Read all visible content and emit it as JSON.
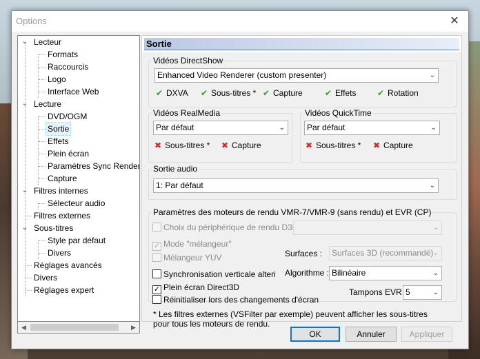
{
  "window": {
    "title": "Options",
    "close_glyph": "✕"
  },
  "tree": [
    {
      "label": "Lecteur",
      "twisty": "⌄"
    },
    {
      "label": "Formats"
    },
    {
      "label": "Raccourcis"
    },
    {
      "label": "Logo"
    },
    {
      "label": "Interface Web"
    },
    {
      "label": "Lecture",
      "twisty": "⌄"
    },
    {
      "label": "DVD/OGM"
    },
    {
      "label": "Sortie",
      "selected": true
    },
    {
      "label": "Effets"
    },
    {
      "label": "Plein écran"
    },
    {
      "label": "Paramètres Sync Render"
    },
    {
      "label": "Capture"
    },
    {
      "label": "Filtres internes",
      "twisty": "⌄"
    },
    {
      "label": "Sélecteur audio"
    },
    {
      "label": "Filtres externes"
    },
    {
      "label": "Sous-titres",
      "twisty": "⌄"
    },
    {
      "label": "Style par défaut"
    },
    {
      "label": "Divers"
    },
    {
      "label": "Réglages avancés"
    },
    {
      "label": "Divers"
    },
    {
      "label": "Réglages expert"
    }
  ],
  "page": {
    "header": "Sortie",
    "directshow": {
      "legend": "Vidéos DirectShow",
      "renderer": "Enhanced Video Renderer (custom presenter)",
      "caps": [
        "DXVA",
        "Sous-titres *",
        "Capture",
        "Effets",
        "Rotation"
      ]
    },
    "realmedia": {
      "legend": "Vidéos RealMedia",
      "value": "Par défaut",
      "caps": [
        "Sous-titres *",
        "Capture"
      ]
    },
    "quicktime": {
      "legend": "Vidéos QuickTime",
      "value": "Par défaut",
      "caps": [
        "Sous-titres *",
        "Capture"
      ]
    },
    "audio": {
      "legend": "Sortie audio",
      "value": "1: Par défaut"
    },
    "vmr": {
      "legend": "Paramètres des moteurs de rendu VMR-7/VMR-9 (sans rendu) et EVR (CP)",
      "d3d9_device": "Choix du périphérique de rendu D3D9",
      "mixer_mode": "Mode \"mélangeur\"",
      "mixer_yuv": "Mélangeur YUV",
      "vsync": "Synchronisation verticale alteri",
      "fullscreen_d3d": "Plein écran Direct3D",
      "reset_on_change": "Réinitialiser lors des changements d'écran",
      "surfaces_label": "Surfaces :",
      "surfaces_value": "Surfaces 3D (recommandé)",
      "algorithm_label": "Algorithme :",
      "algorithm_value": "Bilinéaire",
      "buffers_label": "Tampons EVR :",
      "buffers_value": "5"
    },
    "footnote": "* Les filtres externes (VSFilter par exemple) peuvent afficher les sous-titres pour tous les moteurs de rendu."
  },
  "buttons": {
    "ok": "OK",
    "cancel": "Annuler",
    "apply": "Appliquer"
  },
  "glyphs": {
    "check": "✔",
    "cross": "✖",
    "dropdown": "⌄",
    "tick": "✓",
    "left": "◀",
    "right": "▶"
  }
}
